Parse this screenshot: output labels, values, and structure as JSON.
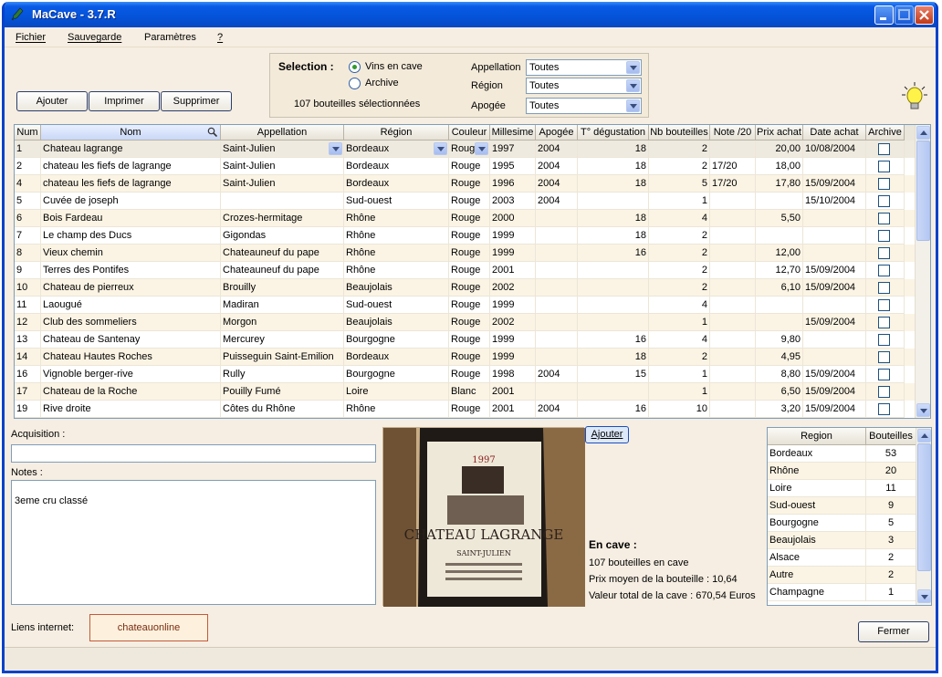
{
  "window": {
    "title": "MaCave - 3.7.R"
  },
  "menu": [
    "Fichier",
    "Sauvegarde",
    "Paramètres",
    "?"
  ],
  "toolbar": {
    "add": "Ajouter",
    "print": "Imprimer",
    "delete": "Supprimer"
  },
  "selection": {
    "title": "Selection :",
    "options": [
      {
        "label": "Vins en cave",
        "checked": true
      },
      {
        "label": "Archive",
        "checked": false
      }
    ],
    "count_text": "107 bouteilles sélectionnées",
    "filters": [
      {
        "label": "Appellation",
        "value": "Toutes"
      },
      {
        "label": "Région",
        "value": "Toutes"
      },
      {
        "label": "Apogée",
        "value": "Toutes"
      }
    ]
  },
  "grid": {
    "columns": [
      "Num",
      "Nom",
      "Appellation",
      "Région",
      "Couleur",
      "Millesime",
      "Apogée",
      "T° dégustation",
      "Nb bouteilles",
      "Note /20",
      "Prix achat",
      "Date achat",
      "Archive"
    ],
    "rows": [
      [
        "1",
        "Chateau lagrange",
        "Saint-Julien",
        "Bordeaux",
        "Roug",
        "1997",
        "2004",
        "18",
        "2",
        "",
        "20,00",
        "10/08/2004"
      ],
      [
        "2",
        "chateau les fiefs de lagrange",
        "Saint-Julien",
        "Bordeaux",
        "Rouge",
        "1995",
        "2004",
        "18",
        "2",
        "17/20",
        "18,00",
        ""
      ],
      [
        "4",
        "chateau les fiefs de lagrange",
        "Saint-Julien",
        "Bordeaux",
        "Rouge",
        "1996",
        "2004",
        "18",
        "5",
        "17/20",
        "17,80",
        "15/09/2004"
      ],
      [
        "5",
        "Cuvée de joseph",
        "",
        "Sud-ouest",
        "Rouge",
        "2003",
        "2004",
        "",
        "1",
        "",
        "",
        "15/10/2004"
      ],
      [
        "6",
        "Bois Fardeau",
        "Crozes-hermitage",
        "Rhône",
        "Rouge",
        "2000",
        "",
        "18",
        "4",
        "",
        "5,50",
        ""
      ],
      [
        "7",
        "Le champ des Ducs",
        "Gigondas",
        "Rhône",
        "Rouge",
        "1999",
        "",
        "18",
        "2",
        "",
        "",
        ""
      ],
      [
        "8",
        "Vieux chemin",
        "Chateauneuf du pape",
        "Rhône",
        "Rouge",
        "1999",
        "",
        "16",
        "2",
        "",
        "12,00",
        ""
      ],
      [
        "9",
        "Terres des Pontifes",
        "Chateauneuf du pape",
        "Rhône",
        "Rouge",
        "2001",
        "",
        "",
        "2",
        "",
        "12,70",
        "15/09/2004"
      ],
      [
        "10",
        "Chateau de pierreux",
        "Brouilly",
        "Beaujolais",
        "Rouge",
        "2002",
        "",
        "",
        "2",
        "",
        "6,10",
        "15/09/2004"
      ],
      [
        "11",
        "Laougué",
        "Madiran",
        "Sud-ouest",
        "Rouge",
        "1999",
        "",
        "",
        "4",
        "",
        "",
        ""
      ],
      [
        "12",
        "Club des sommeliers",
        "Morgon",
        "Beaujolais",
        "Rouge",
        "2002",
        "",
        "",
        "1",
        "",
        "",
        "15/09/2004"
      ],
      [
        "13",
        "Chateau de Santenay",
        "Mercurey",
        "Bourgogne",
        "Rouge",
        "1999",
        "",
        "16",
        "4",
        "",
        "9,80",
        ""
      ],
      [
        "14",
        "Chateau Hautes Roches",
        "Puisseguin Saint-Emilion",
        "Bordeaux",
        "Rouge",
        "1999",
        "",
        "18",
        "2",
        "",
        "4,95",
        ""
      ],
      [
        "16",
        "Vignoble berger-rive",
        "Rully",
        "Bourgogne",
        "Rouge",
        "1998",
        "2004",
        "15",
        "1",
        "",
        "8,80",
        "15/09/2004"
      ],
      [
        "17",
        "Chateau de la Roche",
        "Pouilly Fumé",
        "Loire",
        "Blanc",
        "2001",
        "",
        "",
        "1",
        "",
        "6,50",
        "15/09/2004"
      ],
      [
        "19",
        "Rive droite",
        "Côtes du Rhône",
        "Rhône",
        "Rouge",
        "2001",
        "2004",
        "16",
        "10",
        "",
        "3,20",
        "15/09/2004"
      ]
    ]
  },
  "details": {
    "acquisition_label": "Acquisition :",
    "acquisition_value": "",
    "notes_label": "Notes :",
    "notes_value": "3eme cru classé",
    "photo_add": "Ajouter",
    "photo_text": {
      "name": "CHATEAU LAGRANGE",
      "year": "1997",
      "appellation": "SAINT-JULIEN"
    }
  },
  "stats": {
    "title": "En cave :",
    "bottles": "107 bouteilles en cave",
    "avg_price": "Prix moyen de la bouteille : 10,64",
    "total_value": "Valeur total de la cave : 670,54 Euros"
  },
  "regions": {
    "columns": [
      "Region",
      "Bouteilles"
    ],
    "rows": [
      [
        "Bordeaux",
        "53"
      ],
      [
        "Rhône",
        "20"
      ],
      [
        "Loire",
        "11"
      ],
      [
        "Sud-ouest",
        "9"
      ],
      [
        "Bourgogne",
        "5"
      ],
      [
        "Beaujolais",
        "3"
      ],
      [
        "Alsace",
        "2"
      ],
      [
        "Autre",
        "2"
      ],
      [
        "Champagne",
        "1"
      ]
    ]
  },
  "links": {
    "label": "Liens internet:",
    "value": "chateauonline"
  },
  "close_button": "Fermer"
}
